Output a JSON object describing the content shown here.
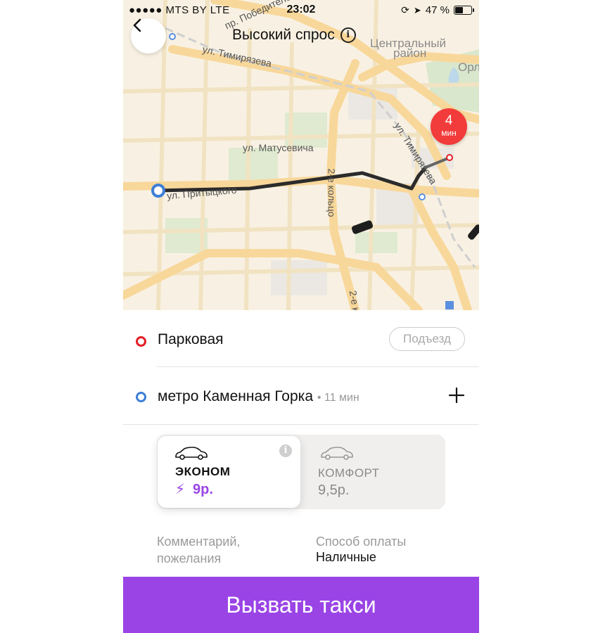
{
  "status_bar": {
    "carrier": "●●●●● MTS BY  LTE",
    "time": "23:02",
    "battery_percent": "47 %"
  },
  "map": {
    "title": "Высокий спрос",
    "eta_badge": {
      "value": "4",
      "unit": "мин"
    },
    "labels": {
      "district": "Центральный",
      "district2": "район",
      "timiryazeva_top": "ул. Тимирязева",
      "pobediteley": "пр. Победителей",
      "matusevicha": "ул. Матусевича",
      "pritytskogo": "ул. Притыцкого",
      "kolco1": "2-е кольцо",
      "kolco2": "2-е к",
      "timiryazeva_right": "ул. Тимирязева",
      "orl": "Орл"
    }
  },
  "route": {
    "from": {
      "name": "Парковая",
      "entrance_button": "Подъезд"
    },
    "to": {
      "name": "метро Каменная Горка",
      "eta": "11 мин"
    }
  },
  "tariffs": [
    {
      "name": "ЭКОНОМ",
      "price": "9р.",
      "selected": true,
      "surge": true
    },
    {
      "name": "КОМФОРТ",
      "price": "9,5р.",
      "selected": false
    }
  ],
  "options": {
    "comment_label_line1": "Комментарий,",
    "comment_label_line2": "пожелания",
    "payment_label": "Способ оплаты",
    "payment_value": "Наличные"
  },
  "call_button": "Вызвать такси",
  "colors": {
    "accent": "#9a44e6",
    "surge": "#9a44e6",
    "from_dot": "#e31e24",
    "to_dot": "#3d7fd6",
    "eta_badge": "#f23b3b"
  },
  "icons": {
    "back": "chevron-left-icon",
    "info": "info-icon",
    "car": "car-icon",
    "lightning": "lightning-icon",
    "plus": "plus-icon"
  }
}
